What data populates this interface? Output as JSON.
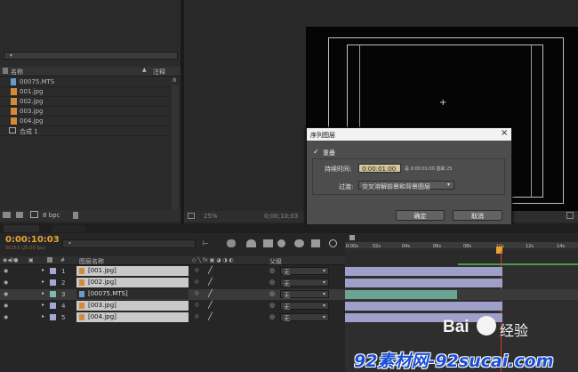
{
  "project": {
    "column_name": "名称",
    "column_comment": "注释",
    "items": [
      {
        "name": "00075.MTS",
        "type": "video"
      },
      {
        "name": "001.jpg",
        "type": "image"
      },
      {
        "name": "002.jpg",
        "type": "image"
      },
      {
        "name": "003.jpg",
        "type": "image"
      },
      {
        "name": "004.jpg",
        "type": "image"
      },
      {
        "name": "合成 1",
        "type": "comp"
      }
    ],
    "bpc_label": "8 bpc"
  },
  "viewer": {
    "zoom": "25%",
    "timecode": "0;00;10;03"
  },
  "dialog": {
    "title": "序列图层",
    "overlap_label": "重叠",
    "overlap_checked": true,
    "duration_label": "持续时间:",
    "duration_value": "0:00:01:00",
    "duration_info": "是 0:00:01:00  基础 25",
    "transition_label": "过渡:",
    "transition_value": "交叉溶解前景和背景图层",
    "ok_label": "确定",
    "cancel_label": "取消"
  },
  "timeline": {
    "current_time": "0:00:10:03",
    "frame_info": "00253 (25.00 fps)",
    "col_layer_name": "图层名称",
    "col_parent": "父级",
    "ruler_labels": [
      "0:00s",
      "02s",
      "04s",
      "06s",
      "08s",
      "10s",
      "12s",
      "14s"
    ],
    "layers": [
      {
        "num": "1",
        "name": "[001.jpg]",
        "type": "image",
        "color": "#a7a7d6",
        "parent": "无"
      },
      {
        "num": "2",
        "name": "[002.jpg]",
        "type": "image",
        "color": "#a7a7d6",
        "parent": "无"
      },
      {
        "num": "3",
        "name": "[00075.MTS]",
        "type": "video",
        "color": "#7fb9a9",
        "parent": "无"
      },
      {
        "num": "4",
        "name": "[003.jpg]",
        "type": "image",
        "color": "#a7a7d6",
        "parent": "无"
      },
      {
        "num": "5",
        "name": "[004.jpg]",
        "type": "image",
        "color": "#a7a7d6",
        "parent": "无"
      }
    ]
  },
  "watermark": {
    "baidu": "Bai",
    "baidu_cn": "经验",
    "site": "92素材网-92sucai.com"
  },
  "colors": {
    "accent_time": "#e8a33a",
    "playhead": "#d43a2a",
    "layer_bar": "#9fa0c9",
    "layer_bar_video": "#6aa594"
  }
}
